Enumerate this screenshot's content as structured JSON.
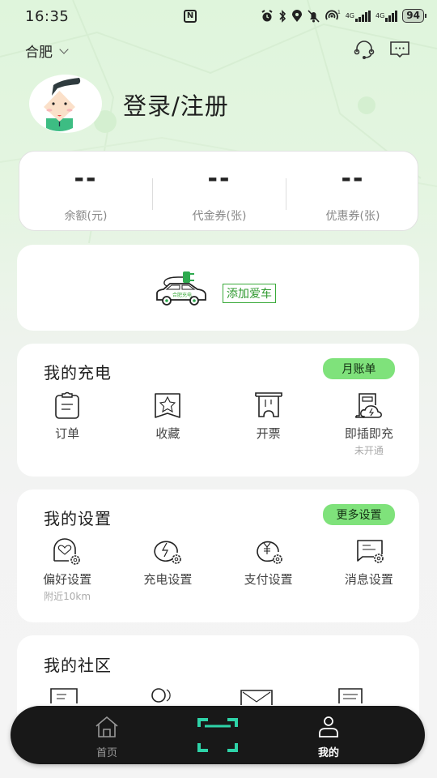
{
  "status_bar": {
    "time": "16:35",
    "nfc": "N",
    "network_1": "4G",
    "network_2": "4G",
    "battery": "94",
    "icons": [
      "alarm-icon",
      "bluetooth-icon",
      "location-icon",
      "mute-icon",
      "hotspot-icon",
      "signal-icon",
      "signal-icon",
      "battery-icon"
    ]
  },
  "header": {
    "city": "合肥",
    "icons": [
      "headset-icon",
      "message-icon"
    ]
  },
  "profile": {
    "login_label": "登录/注册"
  },
  "stats": [
    {
      "value": "--",
      "label": "余额(元)"
    },
    {
      "value": "--",
      "label": "代金券(张)"
    },
    {
      "value": "--",
      "label": "优惠券(张)"
    }
  ],
  "car": {
    "car_text": "合肥充电",
    "add_label": "添加爱车"
  },
  "charging": {
    "title": "我的充电",
    "action": "月账单",
    "items": [
      {
        "label": "订单",
        "icon": "order-icon"
      },
      {
        "label": "收藏",
        "icon": "favorite-icon"
      },
      {
        "label": "开票",
        "icon": "invoice-icon"
      },
      {
        "label": "即插即充",
        "sub": "未开通",
        "icon": "plug-charge-icon"
      }
    ]
  },
  "settings": {
    "title": "我的设置",
    "action": "更多设置",
    "items": [
      {
        "label": "偏好设置",
        "sub": "附近10km",
        "icon": "preference-settings-icon"
      },
      {
        "label": "充电设置",
        "icon": "charging-settings-icon"
      },
      {
        "label": "支付设置",
        "icon": "payment-settings-icon"
      },
      {
        "label": "消息设置",
        "icon": "message-settings-icon"
      }
    ]
  },
  "community": {
    "title": "我的社区"
  },
  "tabbar": {
    "home": "首页",
    "scan": "",
    "mine": "我的",
    "active": "mine",
    "scan_color": "#2ed3a8"
  },
  "colors": {
    "accent_green": "#7fe27b",
    "car_green": "#3aaa3a"
  }
}
